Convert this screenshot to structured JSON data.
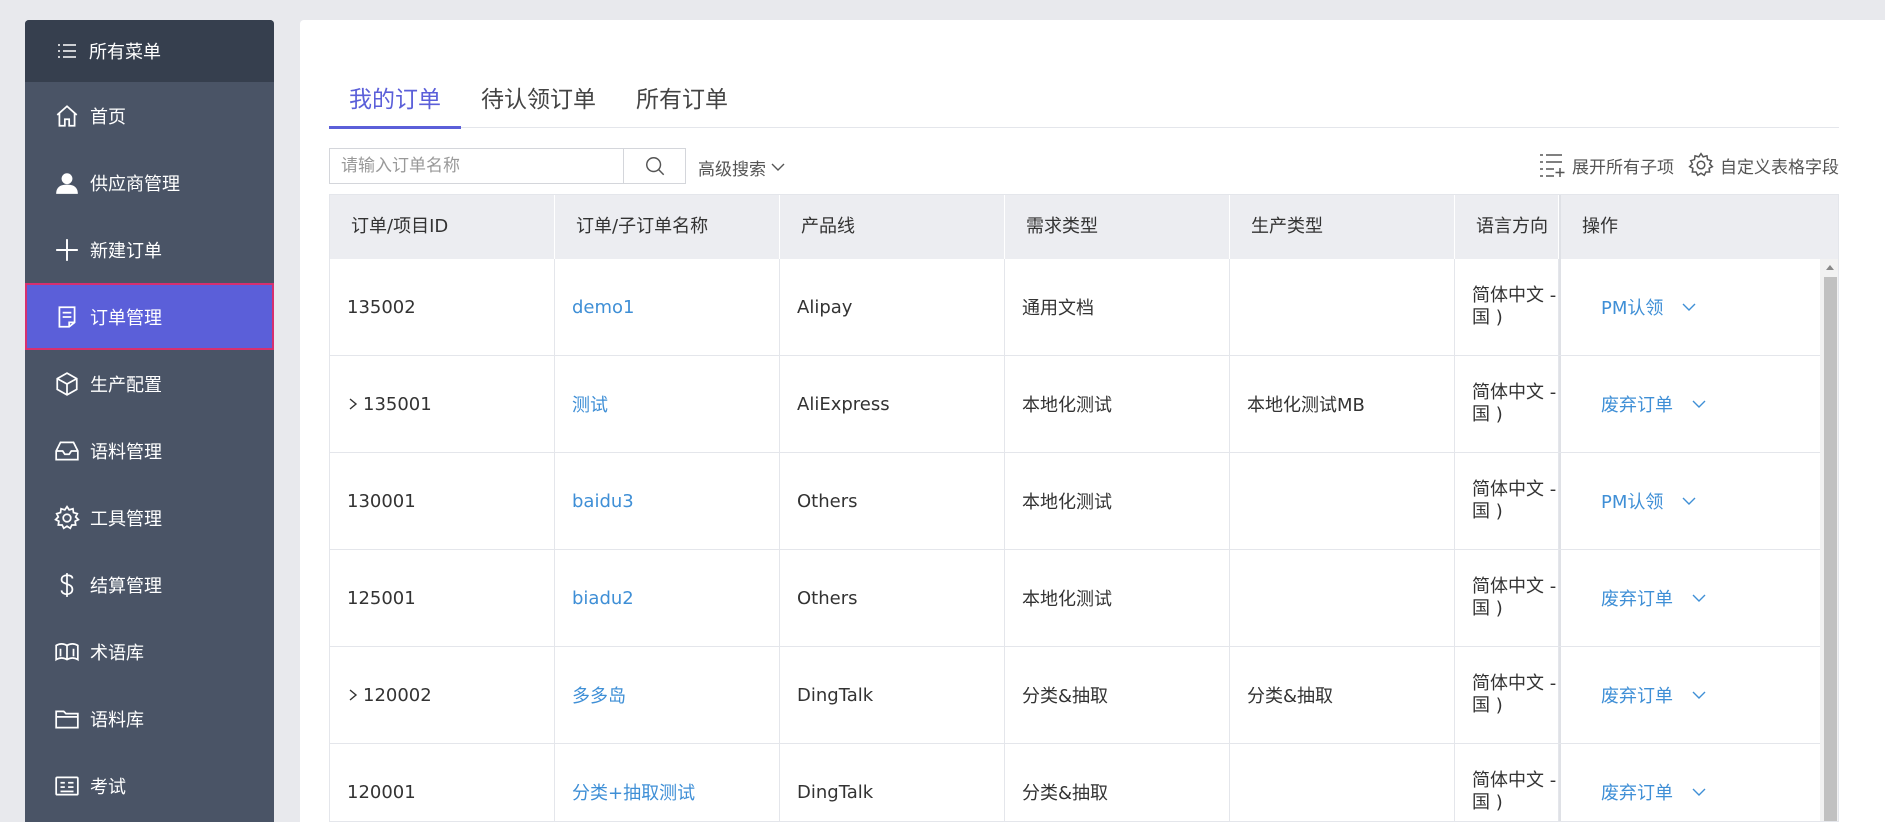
{
  "sidebar": {
    "header": {
      "label": "所有菜单",
      "icon": "list-icon"
    },
    "items": [
      {
        "label": "首页",
        "icon": "home-icon"
      },
      {
        "label": "供应商管理",
        "icon": "user-icon"
      },
      {
        "label": "新建订单",
        "icon": "plus-icon"
      },
      {
        "label": "订单管理",
        "icon": "order-icon",
        "active": true
      },
      {
        "label": "生产配置",
        "icon": "box-icon"
      },
      {
        "label": "语料管理",
        "icon": "inbox-icon"
      },
      {
        "label": "工具管理",
        "icon": "gear-icon"
      },
      {
        "label": "结算管理",
        "icon": "dollar-icon"
      },
      {
        "label": "术语库",
        "icon": "book-icon"
      },
      {
        "label": "语料库",
        "icon": "folder-icon"
      },
      {
        "label": "考试",
        "icon": "id-card-icon"
      }
    ]
  },
  "tabs": [
    {
      "label": "我的订单",
      "active": true
    },
    {
      "label": "待认领订单"
    },
    {
      "label": "所有订单"
    }
  ],
  "toolbar": {
    "search_placeholder": "请输入订单名称",
    "advanced_search": "高级搜索",
    "expand_all": "展开所有子项",
    "customize_fields": "自定义表格字段"
  },
  "table": {
    "columns": [
      "订单/项目ID",
      "订单/子订单名称",
      "产品线",
      "需求类型",
      "生产类型",
      "语言方向",
      "操作"
    ],
    "rows": [
      {
        "id": "135002",
        "name": "demo1",
        "product": "Alipay",
        "demand": "通用文档",
        "production": "",
        "lang1": "简体中文 -",
        "lang2": "国 )",
        "action": "PM认领",
        "expandable": false
      },
      {
        "id": "135001",
        "name": "测试",
        "product": "AliExpress",
        "demand": "本地化测试",
        "production": "本地化测试MB",
        "lang1": "简体中文 -",
        "lang2": "国 )",
        "action": "废弃订单",
        "expandable": true
      },
      {
        "id": "130001",
        "name": "baidu3",
        "product": "Others",
        "demand": "本地化测试",
        "production": "",
        "lang1": "简体中文 -",
        "lang2": "国 )",
        "action": "PM认领",
        "expandable": false
      },
      {
        "id": "125001",
        "name": "biadu2",
        "product": "Others",
        "demand": "本地化测试",
        "production": "",
        "lang1": "简体中文 -",
        "lang2": "国 )",
        "action": "废弃订单",
        "expandable": false
      },
      {
        "id": "120002",
        "name": "多多岛",
        "product": "DingTalk",
        "demand": "分类&抽取",
        "production": "分类&抽取",
        "lang1": "简体中文 -",
        "lang2": "国 )",
        "action": "废弃订单",
        "expandable": true
      },
      {
        "id": "120001",
        "name": "分类+抽取测试",
        "product": "DingTalk",
        "demand": "分类&抽取",
        "production": "",
        "lang1": "简体中文 -",
        "lang2": "国 )",
        "action": "废弃订单",
        "expandable": false
      }
    ]
  },
  "colors": {
    "sidebar_bg": "#4a5466",
    "sidebar_header_bg": "#363f4e",
    "active_bg": "#5b5fd9",
    "active_border": "#d6306f",
    "link": "#3f8fd6"
  }
}
